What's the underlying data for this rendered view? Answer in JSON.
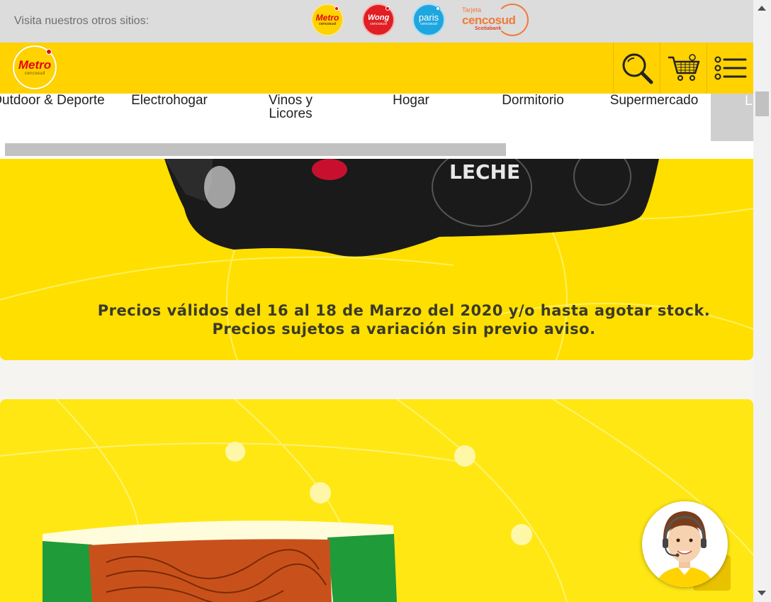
{
  "sites_bar": {
    "label": "Visita nuestros otros sitios:",
    "sites": [
      {
        "name": "Metro",
        "sub": "cencosud"
      },
      {
        "name": "Wong",
        "sub": "cencosud"
      },
      {
        "name": "paris",
        "sub": "cencosud"
      }
    ],
    "tarjeta": {
      "line1": "Tarjeta",
      "line2": "cencosud",
      "line3": "Scotiabank"
    }
  },
  "header": {
    "brand_name": "Metro",
    "brand_sub": "cencosud",
    "icons": [
      "search-icon",
      "cart-icon",
      "menu-list-icon"
    ]
  },
  "categories": [
    {
      "label": "Outdoor & Deporte"
    },
    {
      "label": "Electrohogar"
    },
    {
      "label": "Vinos y Licores"
    },
    {
      "label": "Hogar"
    },
    {
      "label": "Dormitorio"
    },
    {
      "label": "Supermercado"
    },
    {
      "label": "L"
    }
  ],
  "banner1": {
    "line1": "Precios válidos del 16 al 18 de Marzo del 2020 y/o hasta agotar stock.",
    "line2": "Precios sujetos a variación sin previo aviso.",
    "product_text": "LECHE"
  },
  "colors": {
    "brand_yellow": "#ffd200",
    "brand_red": "#e30613",
    "banner_yellow": "#ffdf00"
  }
}
